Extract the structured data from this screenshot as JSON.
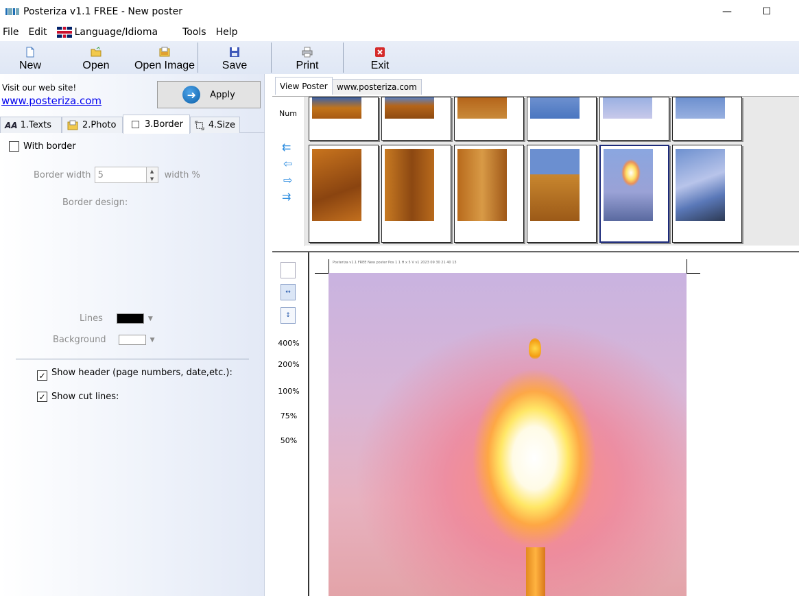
{
  "window": {
    "title": "Posteriza v1.1 FREE - New poster",
    "minimize_glyph": "—",
    "maximize_glyph": "☐"
  },
  "menu": {
    "file": "File",
    "edit": "Edit",
    "language": "Language/Idioma",
    "tools": "Tools",
    "help": "Help"
  },
  "toolbar": {
    "new": "New",
    "open": "Open",
    "open_image": "Open Image",
    "save": "Save",
    "print": "Print",
    "exit": "Exit"
  },
  "left_panel": {
    "visit_text": "Visit our web site!",
    "visit_link": "www.posteriza.com",
    "apply": "Apply",
    "tabs": {
      "texts": "1.Texts",
      "photo": "2.Photo",
      "border": "3.Border",
      "size": "4.Size"
    },
    "with_border": "With border",
    "border_width_label": "Border width",
    "border_width_value": "5",
    "border_width_unit": "width %",
    "border_design_label": "Border design:",
    "lines_label": "Lines",
    "background_label": "Background",
    "lines_color": "#000000",
    "background_color": "#ffffff",
    "show_header": "Show header (page numbers, date,etc.):",
    "show_cut_lines": "Show cut lines:",
    "with_border_checked": false,
    "show_header_checked": true,
    "show_cut_lines_checked": true
  },
  "right_panel": {
    "tabs": {
      "view_poster": "View Poster",
      "website": "www.posteriza.com"
    },
    "num_label": "Num",
    "zoom_levels": [
      "400%",
      "200%",
      "100%",
      "75%",
      "50%"
    ],
    "poster_header": "Posteriza v1.1 FREE  New poster  Pos 1 1 H x 5 V  v1 2023 09 30 21 40 13"
  },
  "colors": {
    "accent": "#1f6fb5",
    "link": "#0000ee",
    "selected_thumb_border": "#1c2a7a"
  }
}
